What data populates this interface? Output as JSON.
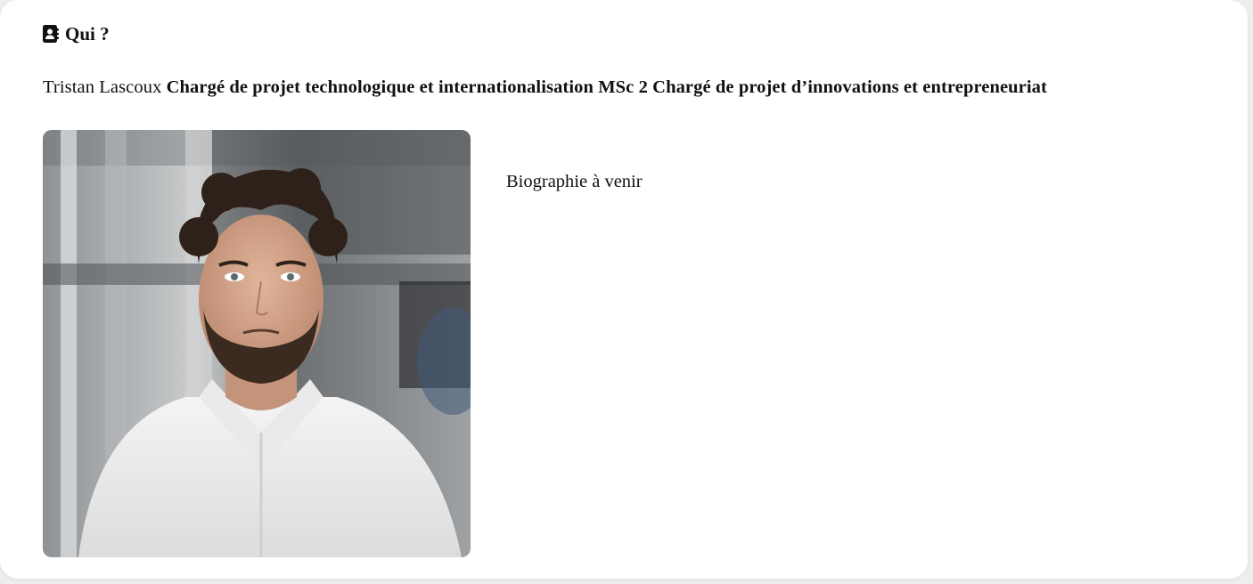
{
  "section": {
    "icon": "contact-book-icon",
    "title": "Qui ?"
  },
  "profile": {
    "name": "Tristan Lascoux",
    "roles": "Chargé de projet technologique et internationalisation MSc 2 Chargé de projet d’innovations et entrepreneuriat",
    "photo": "portrait-photo",
    "biography": "Biographie à venir"
  }
}
